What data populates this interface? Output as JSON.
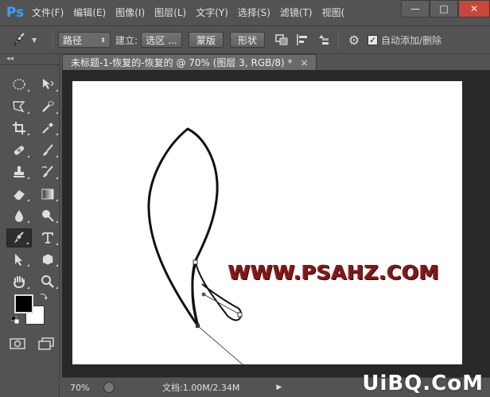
{
  "app": {
    "logo": "Ps"
  },
  "menu": [
    "文件(F)",
    "编辑(E)",
    "图像(I)",
    "图层(L)",
    "文字(Y)",
    "选择(S)",
    "滤镜(T)",
    "视图("
  ],
  "window_controls": {
    "minimize": "—",
    "maximize": "□",
    "close": "✕"
  },
  "options": {
    "mode_select": "路径",
    "build_label": "建立:",
    "selection_button": "选区 ...",
    "mask_button": "蒙版",
    "shape_button": "形状",
    "auto_add_delete_label": "自动添加/删除",
    "auto_add_delete_checked": true
  },
  "toolbox": {
    "collapse": "◂◂"
  },
  "document": {
    "tab_title": "未标题-1-恢复的-恢复的 @ 70% (图层 3, RGB/8) *",
    "tab_close": "×",
    "canvas_text": "WWW.PSAHZ.COM"
  },
  "status": {
    "zoom": "70%",
    "doc_info": "文档:1.00M/2.34M",
    "arrow": "▶"
  },
  "site_watermark": "UiBQ.CoM",
  "colors": {
    "foreground": "#000000",
    "background": "#ffffff",
    "panel": "#535353",
    "accent": "#3aa0ff"
  }
}
